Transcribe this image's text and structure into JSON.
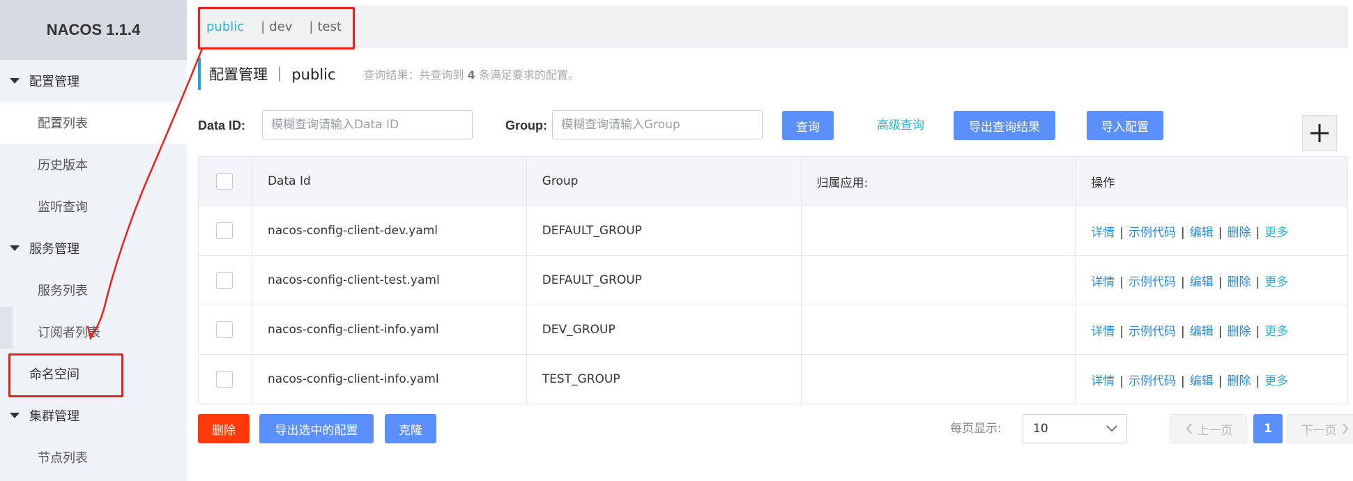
{
  "app": {
    "brand": "NACOS 1.1.4"
  },
  "sidebar": {
    "groups": [
      {
        "label": "配置管理",
        "items": [
          {
            "label": "配置列表"
          },
          {
            "label": "历史版本"
          },
          {
            "label": "监听查询"
          }
        ]
      },
      {
        "label": "服务管理",
        "items": [
          {
            "label": "服务列表"
          },
          {
            "label": "订阅者列表"
          }
        ]
      },
      {
        "label": "集群管理",
        "items": [
          {
            "label": "节点列表"
          }
        ]
      }
    ],
    "namespace": "命名空间"
  },
  "namespaces": {
    "tabs": [
      {
        "label": "public"
      },
      {
        "label": "dev"
      },
      {
        "label": "test"
      }
    ],
    "separator": "|"
  },
  "page": {
    "title": "配置管理 ｜ public",
    "result_prefix": "查询结果：共查询到",
    "result_count": "4",
    "result_suffix": "条满足要求的配置。"
  },
  "search": {
    "dataid_label": "Data ID:",
    "dataid_placeholder": "模糊查询请输入Data ID",
    "group_label": "Group:",
    "group_placeholder": "模糊查询请输入Group",
    "query_button": "查询",
    "advanced_link": "高级查询",
    "export_button": "导出查询结果",
    "import_button": "导入配置"
  },
  "table": {
    "headers": {
      "data_id": "Data Id",
      "group": "Group",
      "app": "归属应用:",
      "ops": "操作"
    },
    "rows": [
      {
        "data_id": "nacos-config-client-dev.yaml",
        "group": "DEFAULT_GROUP",
        "app": ""
      },
      {
        "data_id": "nacos-config-client-test.yaml",
        "group": "DEFAULT_GROUP",
        "app": ""
      },
      {
        "data_id": "nacos-config-client-info.yaml",
        "group": "DEV_GROUP",
        "app": ""
      },
      {
        "data_id": "nacos-config-client-info.yaml",
        "group": "TEST_GROUP",
        "app": ""
      }
    ],
    "actions": {
      "detail": "详情",
      "sample": "示例代码",
      "edit": "编辑",
      "delete": "删除",
      "more": "更多",
      "separator": "|"
    }
  },
  "bottom": {
    "delete_button": "删除",
    "export_selected_button": "导出选中的配置",
    "clone_button": "克隆",
    "page_size_label": "每页显示:",
    "page_size_value": "10",
    "prev": "上一页",
    "current_page": "1",
    "next": "下一页"
  },
  "colors": {
    "accent": "#5b8ff9",
    "danger": "#ff3a0a",
    "link": "#2bb3d6",
    "annotation": "#e8211a"
  }
}
